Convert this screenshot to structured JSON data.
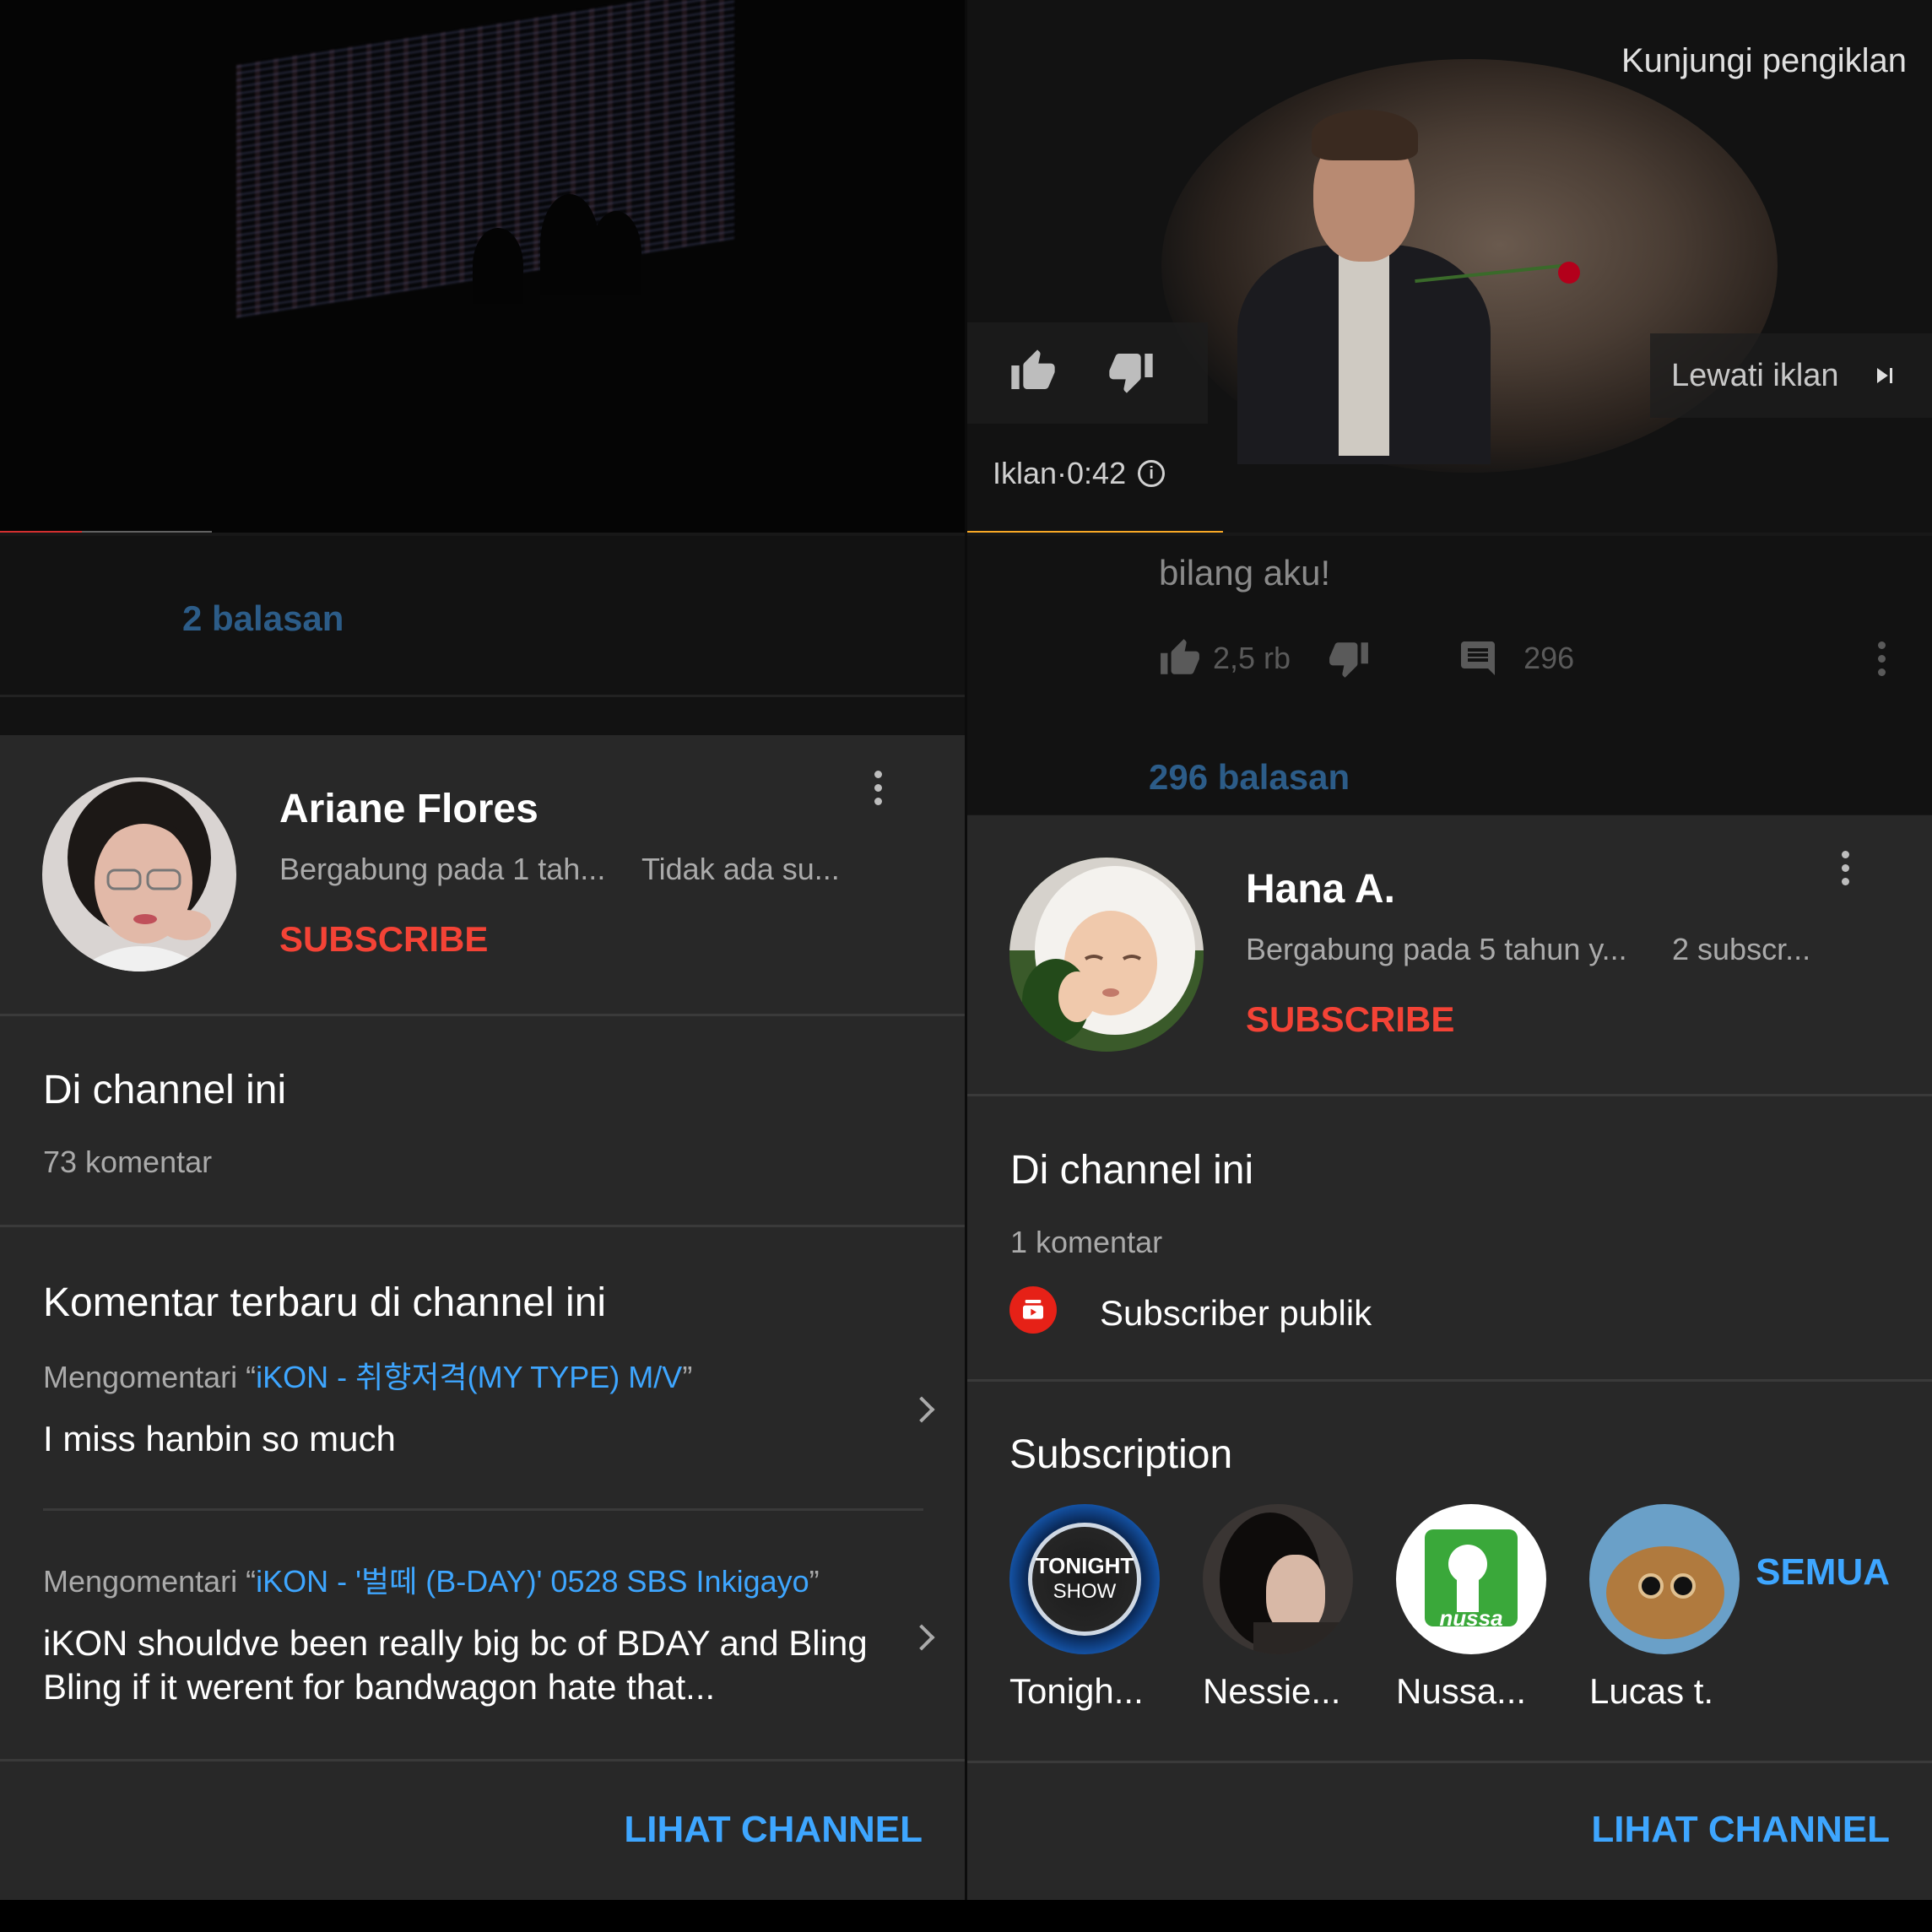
{
  "left": {
    "replies_label": "2 balasan",
    "channel": {
      "name": "Ariane Flores",
      "joined": "Bergabung pada 1 tah...",
      "subscribers": "Tidak ada su...",
      "subscribe_label": "SUBSCRIBE"
    },
    "on_channel": {
      "title": "Di channel ini",
      "count": "73 komentar"
    },
    "recent": {
      "title": "Komentar terbaru di channel ini",
      "items": [
        {
          "prefix": "Mengomentari “",
          "video": "iKON - 취향저격(MY TYPE) M/V",
          "suffix": "”",
          "text": "I miss hanbin so much"
        },
        {
          "prefix": "Mengomentari “",
          "video": "iKON - '벌떼 (B-DAY)' 0528 SBS Inkigayo",
          "suffix": "”",
          "text": "iKON shouldve been really big bc of BDAY and Bling Bling if it werent for bandwagon hate that..."
        }
      ]
    },
    "view_channel_label": "LIHAT CHANNEL",
    "video_progress": {
      "played": 0.085,
      "buffered": 0.22
    }
  },
  "right": {
    "ad": {
      "visit_label": "Kunjungi pengiklan",
      "skip_label": "Lewati iklan",
      "time_label": "Iklan·0:42",
      "progress": 0.265
    },
    "comment": {
      "text": "bilang aku!",
      "likes": "2,5 rb",
      "reply_count": "296",
      "replies_label": "296 balasan"
    },
    "channel": {
      "name": "Hana A.",
      "joined": "Bergabung pada 5 tahun y...",
      "subscribers": "2 subscr...",
      "subscribe_label": "SUBSCRIBE"
    },
    "on_channel": {
      "title": "Di channel ini",
      "count": "1 komentar",
      "public_label": "Subscriber publik"
    },
    "subscriptions": {
      "title": "Subscription",
      "all_label": "SEMUA",
      "items": [
        {
          "name": "Tonigh...",
          "thumb_text_1": "TONIGHT",
          "thumb_text_2": "SHOW"
        },
        {
          "name": "Nessie..."
        },
        {
          "name": "Nussa...",
          "thumb_text_1": "nussa"
        },
        {
          "name": "Lucas t."
        }
      ]
    },
    "view_channel_label": "LIHAT CHANNEL"
  },
  "colors": {
    "accent_blue": "#3ea6ff",
    "subscribe_red": "#f44336",
    "card_bg": "#282828",
    "ad_yellow": "#f9a825",
    "progress_red": "#d32f2f"
  },
  "icons": [
    "thumb-up-icon",
    "thumb-down-icon",
    "comment-icon",
    "more-vert-icon",
    "skip-next-icon",
    "info-icon",
    "chevron-right-icon",
    "public-subscriber-icon"
  ]
}
